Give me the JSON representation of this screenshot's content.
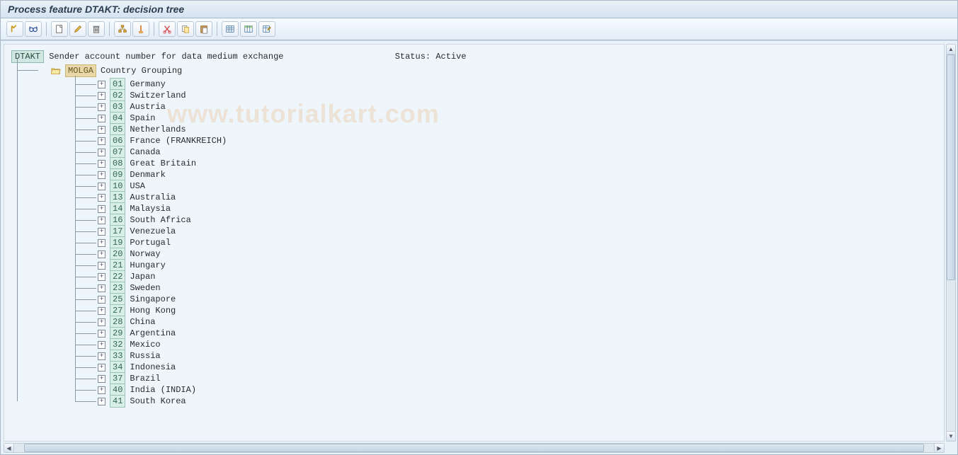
{
  "title": "Process feature DTAKT: decision tree",
  "watermark": "www.tutorialkart.com",
  "root": {
    "feature_code": "DTAKT",
    "feature_desc": "Sender account number for data medium exchange",
    "status_label": "Status:",
    "status_value": "Active"
  },
  "molga": {
    "code": "MOLGA",
    "label": "Country Grouping"
  },
  "countries": [
    {
      "code": "01",
      "name": "Germany"
    },
    {
      "code": "02",
      "name": "Switzerland"
    },
    {
      "code": "03",
      "name": "Austria"
    },
    {
      "code": "04",
      "name": "Spain"
    },
    {
      "code": "05",
      "name": "Netherlands"
    },
    {
      "code": "06",
      "name": "France (FRANKREICH)"
    },
    {
      "code": "07",
      "name": "Canada"
    },
    {
      "code": "08",
      "name": "Great Britain"
    },
    {
      "code": "09",
      "name": "Denmark"
    },
    {
      "code": "10",
      "name": "USA"
    },
    {
      "code": "13",
      "name": "Australia"
    },
    {
      "code": "14",
      "name": "Malaysia"
    },
    {
      "code": "16",
      "name": "South Africa"
    },
    {
      "code": "17",
      "name": "Venezuela"
    },
    {
      "code": "19",
      "name": "Portugal"
    },
    {
      "code": "20",
      "name": "Norway"
    },
    {
      "code": "21",
      "name": "Hungary"
    },
    {
      "code": "22",
      "name": "Japan"
    },
    {
      "code": "23",
      "name": "Sweden"
    },
    {
      "code": "25",
      "name": "Singapore"
    },
    {
      "code": "27",
      "name": "Hong Kong"
    },
    {
      "code": "28",
      "name": "China"
    },
    {
      "code": "29",
      "name": "Argentina"
    },
    {
      "code": "32",
      "name": "Mexico"
    },
    {
      "code": "33",
      "name": "Russia"
    },
    {
      "code": "34",
      "name": "Indonesia"
    },
    {
      "code": "37",
      "name": "Brazil"
    },
    {
      "code": "40",
      "name": "India (INDIA)"
    },
    {
      "code": "41",
      "name": "South Korea"
    }
  ],
  "toolbar_icons": [
    "check-icon",
    "glasses-icon",
    "sep",
    "create-icon",
    "pencil-icon",
    "trash-icon",
    "sep",
    "structure-icon",
    "highlight-icon",
    "sep",
    "cut-icon",
    "copy-icon",
    "paste-icon",
    "sep",
    "table-icon",
    "table-settings-icon",
    "edit-table-icon"
  ]
}
